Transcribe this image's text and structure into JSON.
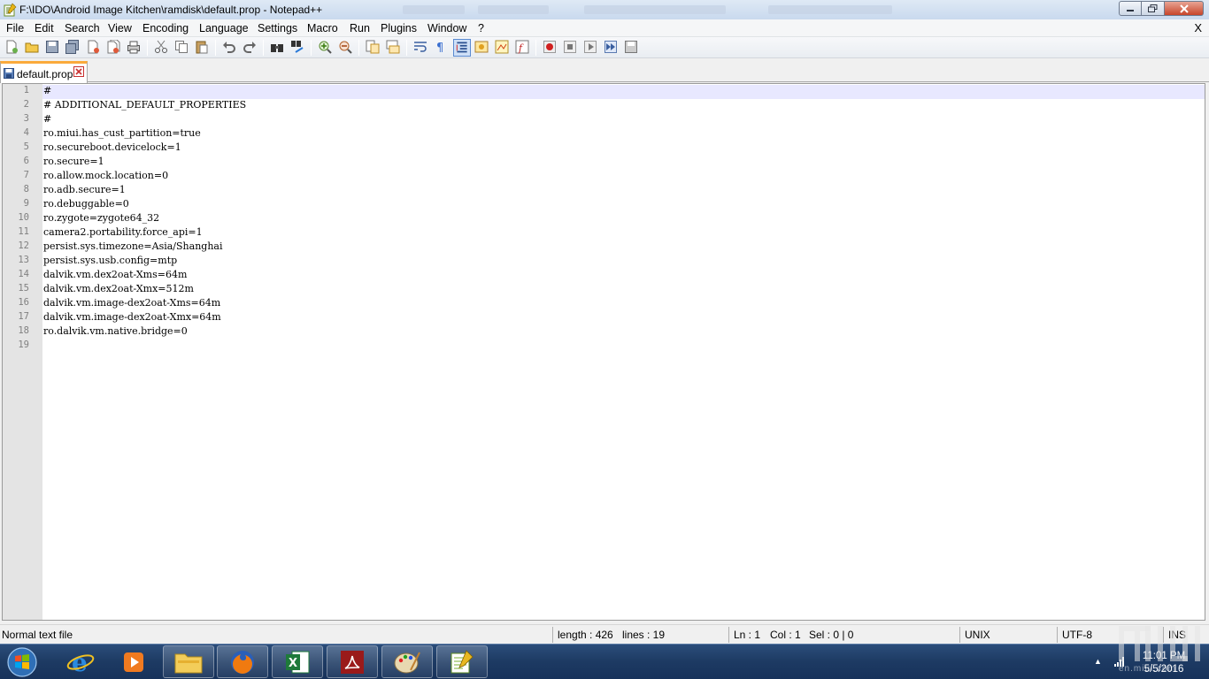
{
  "window": {
    "title": "F:\\IDO\\Android Image Kitchen\\ramdisk\\default.prop - Notepad++"
  },
  "menu": {
    "items": [
      "File",
      "Edit",
      "Search",
      "View",
      "Encoding",
      "Language",
      "Settings",
      "Macro",
      "Run",
      "Plugins",
      "Window",
      "?"
    ],
    "close_label": "X"
  },
  "tab": {
    "label": "default.prop"
  },
  "editor": {
    "line_numbers": [
      "1",
      "2",
      "3",
      "4",
      "5",
      "6",
      "7",
      "8",
      "9",
      "10",
      "11",
      "12",
      "13",
      "14",
      "15",
      "16",
      "17",
      "18",
      "19"
    ],
    "lines": [
      "#",
      "# ADDITIONAL_DEFAULT_PROPERTIES",
      "#",
      "ro.miui.has_cust_partition=true",
      "ro.secureboot.devicelock=1",
      "ro.secure=1",
      "ro.allow.mock.location=0",
      "ro.adb.secure=1",
      "ro.debuggable=0",
      "ro.zygote=zygote64_32",
      "camera2.portability.force_api=1",
      "persist.sys.timezone=Asia/Shanghai",
      "persist.sys.usb.config=mtp",
      "dalvik.vm.dex2oat-Xms=64m",
      "dalvik.vm.dex2oat-Xmx=512m",
      "dalvik.vm.image-dex2oat-Xms=64m",
      "dalvik.vm.image-dex2oat-Xmx=64m",
      "ro.dalvik.vm.native.bridge=0",
      ""
    ]
  },
  "status": {
    "file_type": "Normal text file",
    "length": "length : 426",
    "lines": "lines : 19",
    "ln": "Ln : 1",
    "col": "Col : 1",
    "sel": "Sel : 0 | 0",
    "eol": "UNIX",
    "encoding": "UTF-8",
    "mode": "INS"
  },
  "taskbar": {
    "apps": [
      "start-button",
      "internet-explorer",
      "media-player",
      "file-explorer",
      "firefox",
      "excel",
      "pdf-reader",
      "paint",
      "notepad-plus-plus"
    ],
    "time": "11:01 PM",
    "date": "5/5/2016"
  },
  "watermark": {
    "text": "en.miui.com"
  },
  "colors": {
    "tab_accent": "#faaa3c",
    "current_line": "#e8e8ff",
    "gutter": "#e4e4e4",
    "taskbar": "#1d3a63"
  }
}
